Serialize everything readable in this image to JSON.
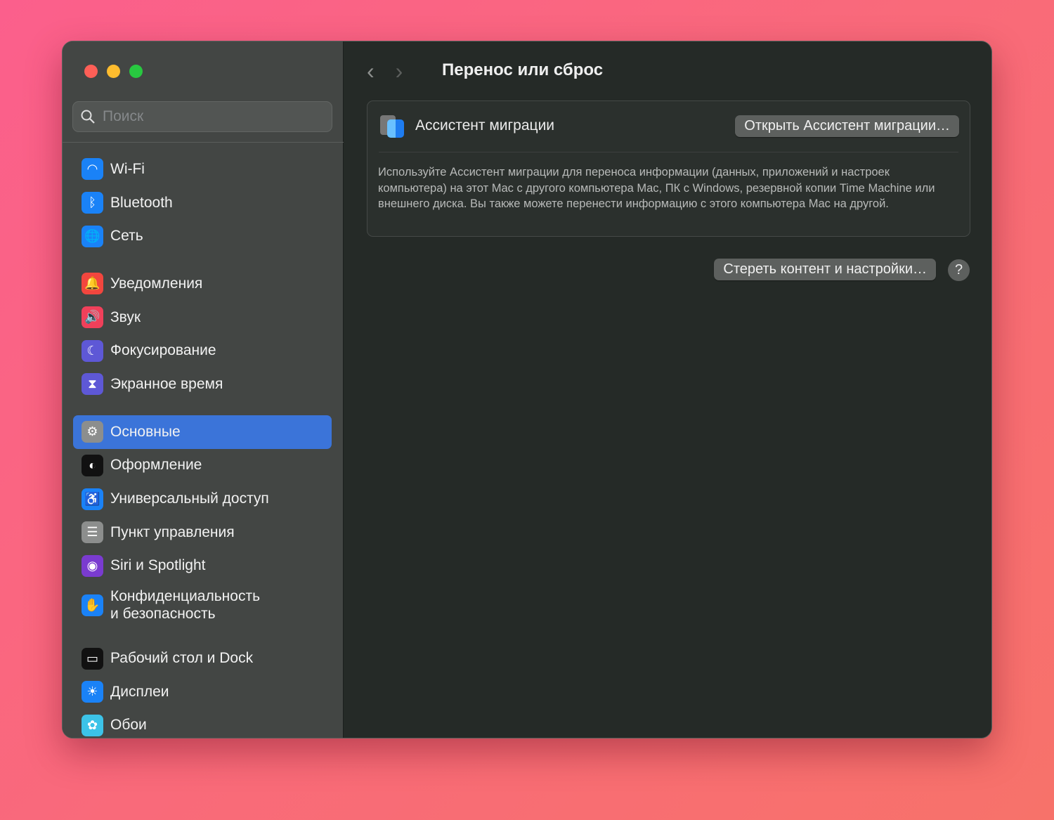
{
  "search": {
    "placeholder": "Поиск"
  },
  "sidebar": {
    "items": [
      {
        "label": "Wi-Fi",
        "icon": "wifi-icon",
        "color": "#1a82f7",
        "glyph": "◠",
        "group_start": false
      },
      {
        "label": "Bluetooth",
        "icon": "bluetooth-icon",
        "color": "#1a82f7",
        "glyph": "ᛒ"
      },
      {
        "label": "Сеть",
        "icon": "globe-icon",
        "color": "#1a82f7",
        "glyph": "🌐"
      },
      {
        "label": "Уведомления",
        "icon": "bell-icon",
        "color": "#f2463e",
        "glyph": "🔔",
        "group_start": true
      },
      {
        "label": "Звук",
        "icon": "speaker-icon",
        "color": "#f0405a",
        "glyph": "🔊"
      },
      {
        "label": "Фокусирование",
        "icon": "moon-icon",
        "color": "#5e58d6",
        "glyph": "☾"
      },
      {
        "label": "Экранное время",
        "icon": "hourglass-icon",
        "color": "#5e58d6",
        "glyph": "⧗"
      },
      {
        "label": "Основные",
        "icon": "gear-icon",
        "color": "#8c8e8d",
        "glyph": "⚙",
        "group_start": true,
        "selected": true
      },
      {
        "label": "Оформление",
        "icon": "appearance-icon",
        "color": "#111",
        "glyph": "◐"
      },
      {
        "label": "Универсальный доступ",
        "icon": "accessibility-icon",
        "color": "#1a82f7",
        "glyph": "♿"
      },
      {
        "label": "Пункт управления",
        "icon": "control-center-icon",
        "color": "#8c8e8d",
        "glyph": "☰"
      },
      {
        "label": "Siri и Spotlight",
        "icon": "siri-icon",
        "color": "#7a3bd0",
        "glyph": "◉"
      },
      {
        "label": "Конфиденциальность\nи безопасность",
        "icon": "hand-icon",
        "color": "#1a82f7",
        "glyph": "✋",
        "two": true
      },
      {
        "label": "Рабочий стол и Dock",
        "icon": "dock-icon",
        "color": "#111",
        "glyph": "▭",
        "group_start": true
      },
      {
        "label": "Дисплеи",
        "icon": "brightness-icon",
        "color": "#1a82f7",
        "glyph": "☀"
      },
      {
        "label": "Обои",
        "icon": "wallpaper-icon",
        "color": "#3cc3e8",
        "glyph": "✿"
      }
    ]
  },
  "main": {
    "back": "‹",
    "forward": "›",
    "title": "Перенос или сброс",
    "migration": {
      "title": "Ассистент миграции",
      "button": "Открыть Ассистент миграции…",
      "description": "Используйте Ассистент миграции для переноса информации (данных, приложений и настроек компьютера) на этот Mac с другого компьютера Mac, ПК с Windows, резервной копии Time Machine или внешнего диска. Вы также можете перенести информацию с этого компьютера Mac на другой."
    },
    "erase_button": "Стереть контент и настройки…",
    "help": "?"
  },
  "colors": {
    "close": "#fe5f57",
    "minimize": "#febc2e",
    "zoom": "#28c840",
    "accent": "#3b74d9"
  }
}
